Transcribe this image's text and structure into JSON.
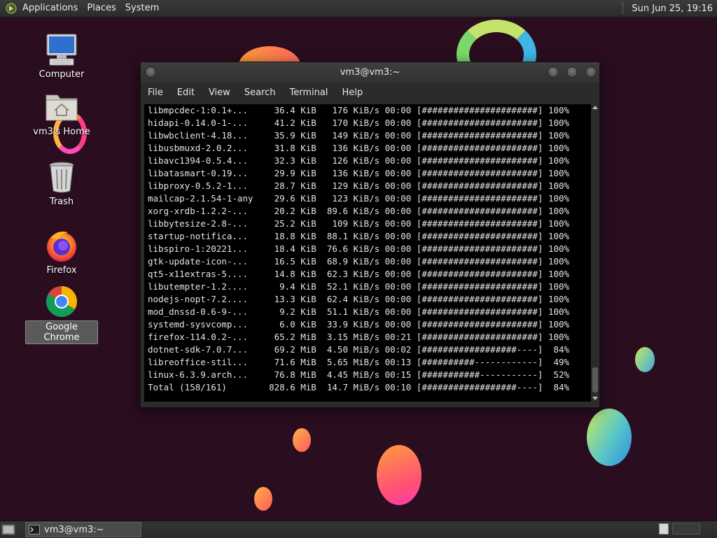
{
  "top_panel": {
    "menus": [
      "Applications",
      "Places",
      "System"
    ],
    "clock": "Sun Jun 25, 19:16"
  },
  "desktop": {
    "icons": [
      {
        "label": "Computer",
        "icon": "computer-icon"
      },
      {
        "label": "vm3's Home",
        "icon": "home-folder-icon"
      },
      {
        "label": "Trash",
        "icon": "trash-icon"
      },
      {
        "label": "Firefox",
        "icon": "firefox-icon"
      },
      {
        "label": "Google Chrome",
        "icon": "chrome-icon"
      }
    ]
  },
  "terminal": {
    "title": "vm3@vm3:~",
    "menu": [
      "File",
      "Edit",
      "View",
      "Search",
      "Terminal",
      "Help"
    ],
    "lines": [
      "libmpcdec-1:0.1+...     36.4 KiB   176 KiB/s 00:00 [######################] 100%",
      "hidapi-0.14.0-1-...     41.2 KiB   170 KiB/s 00:00 [######################] 100%",
      "libwbclient-4.18...     35.9 KiB   149 KiB/s 00:00 [######################] 100%",
      "libusbmuxd-2.0.2...     31.8 KiB   136 KiB/s 00:00 [######################] 100%",
      "libavc1394-0.5.4...     32.3 KiB   126 KiB/s 00:00 [######################] 100%",
      "libatasmart-0.19...     29.9 KiB   136 KiB/s 00:00 [######################] 100%",
      "libproxy-0.5.2-1...     28.7 KiB   129 KiB/s 00:00 [######################] 100%",
      "mailcap-2.1.54-1-any    29.6 KiB   123 KiB/s 00:00 [######################] 100%",
      "xorg-xrdb-1.2.2-...     20.2 KiB  89.6 KiB/s 00:00 [######################] 100%",
      "libbytesize-2.8-...     25.2 KiB   109 KiB/s 00:00 [######################] 100%",
      "startup-notifica...     18.8 KiB  88.1 KiB/s 00:00 [######################] 100%",
      "libspiro-1:20221...     18.4 KiB  76.6 KiB/s 00:00 [######################] 100%",
      "gtk-update-icon-...     16.5 KiB  68.9 KiB/s 00:00 [######################] 100%",
      "qt5-x11extras-5....     14.8 KiB  62.3 KiB/s 00:00 [######################] 100%",
      "libutempter-1.2....      9.4 KiB  52.1 KiB/s 00:00 [######################] 100%",
      "nodejs-nopt-7.2....     13.3 KiB  62.4 KiB/s 00:00 [######################] 100%",
      "mod_dnssd-0.6-9-...      9.2 KiB  51.1 KiB/s 00:00 [######################] 100%",
      "systemd-sysvcomp...      6.0 KiB  33.9 KiB/s 00:00 [######################] 100%",
      "firefox-114.0.2-...     65.2 MiB  3.15 MiB/s 00:21 [######################] 100%",
      "dotnet-sdk-7.0.7...     69.2 MiB  4.50 MiB/s 00:02 [##################----]  84%",
      "libreoffice-stil...     71.6 MiB  5.65 MiB/s 00:13 [##########------------]  49%",
      "linux-6.3.9.arch...     76.8 MiB  4.45 MiB/s 00:15 [###########-----------]  52%",
      "Total (158/161)        828.6 MiB  14.7 MiB/s 00:10 [##################----]  84%"
    ]
  },
  "taskbar": {
    "tasks": [
      {
        "label": "vm3@vm3:~",
        "icon": "terminal-icon"
      }
    ]
  }
}
